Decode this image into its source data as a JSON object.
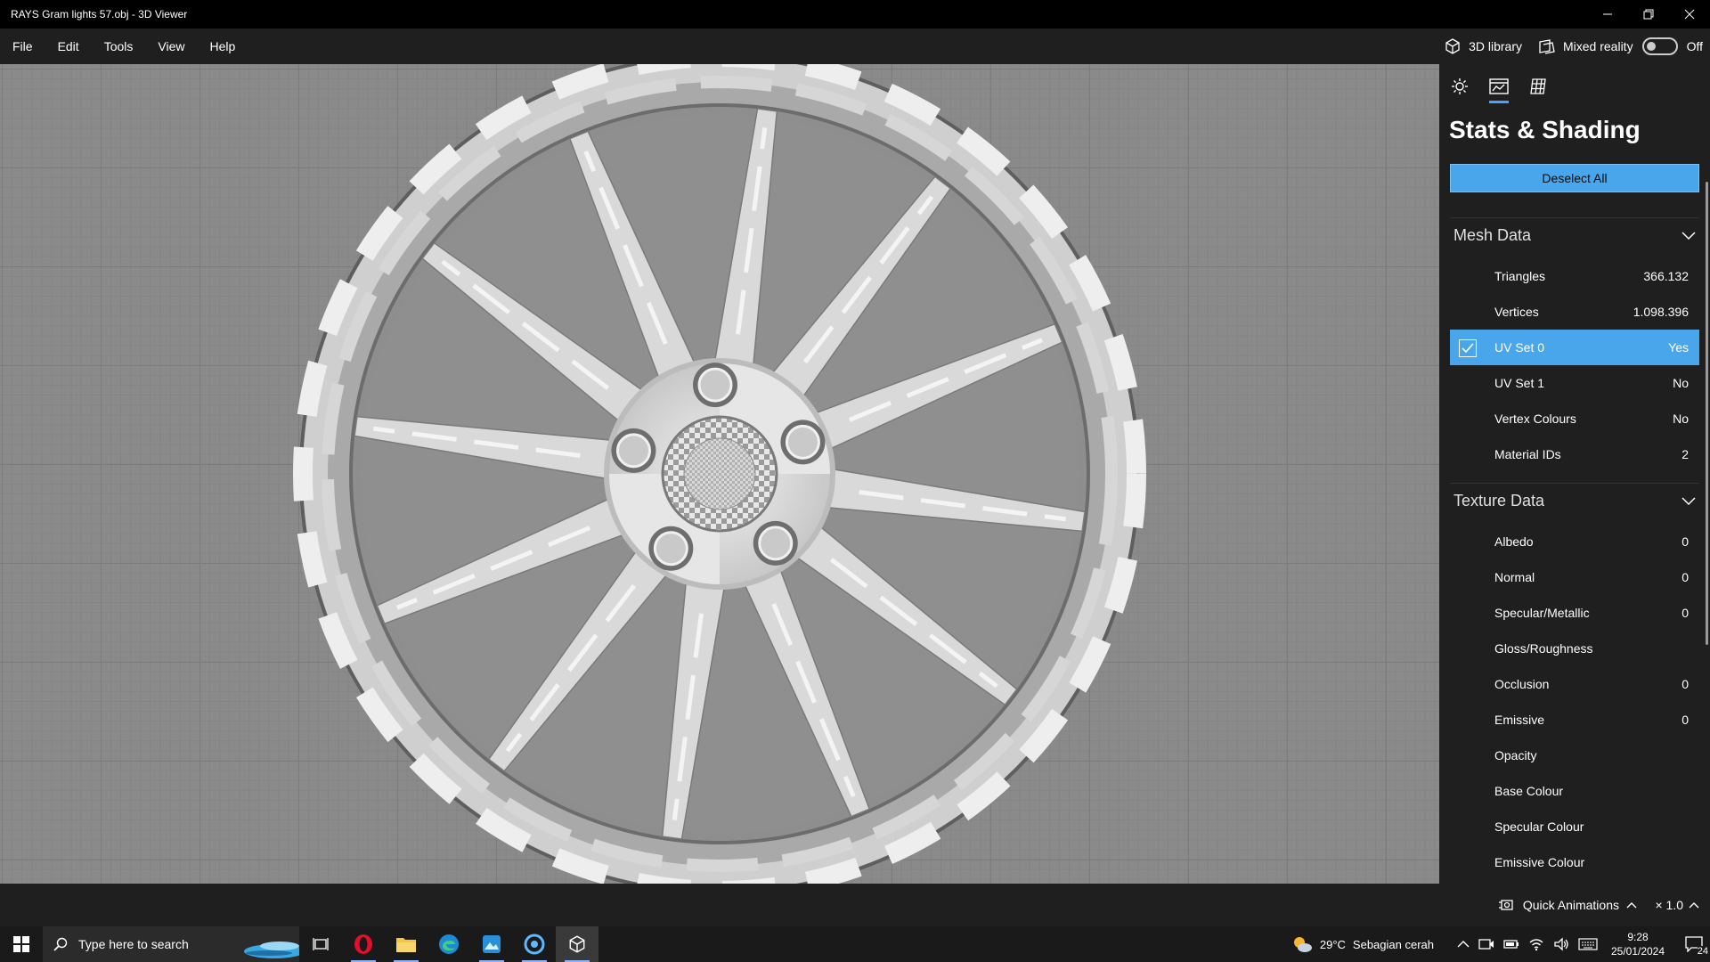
{
  "window": {
    "title": "RAYS Gram lights 57.obj - 3D Viewer"
  },
  "menu": {
    "items": [
      "File",
      "Edit",
      "Tools",
      "View",
      "Help"
    ]
  },
  "header_right": {
    "library_label": "3D library",
    "mixed_reality_label": "Mixed reality",
    "toggle_state": "Off"
  },
  "panel": {
    "title": "Stats & Shading",
    "deselect_label": "Deselect All",
    "mesh_section": "Mesh Data",
    "mesh_rows": [
      {
        "label": "Triangles",
        "value": "366.132"
      },
      {
        "label": "Vertices",
        "value": "1.098.396"
      },
      {
        "label": "UV Set 0",
        "value": "Yes"
      },
      {
        "label": "UV Set 1",
        "value": "No"
      },
      {
        "label": "Vertex Colours",
        "value": "No"
      },
      {
        "label": "Material IDs",
        "value": "2"
      }
    ],
    "texture_section": "Texture Data",
    "texture_rows": [
      {
        "label": "Albedo",
        "value": "0"
      },
      {
        "label": "Normal",
        "value": "0"
      },
      {
        "label": "Specular/Metallic",
        "value": "0"
      },
      {
        "label": "Gloss/Roughness",
        "value": ""
      },
      {
        "label": "Occlusion",
        "value": "0"
      },
      {
        "label": "Emissive",
        "value": "0"
      },
      {
        "label": "Opacity",
        "value": ""
      },
      {
        "label": "Base Colour",
        "value": ""
      },
      {
        "label": "Specular Colour",
        "value": ""
      },
      {
        "label": "Emissive Colour",
        "value": ""
      }
    ]
  },
  "statusbar": {
    "quick_animations": "Quick Animations",
    "speed": "× 1.0"
  },
  "taskbar": {
    "search_placeholder": "Type here to search",
    "weather_temp": "29°C",
    "weather_desc": "Sebagian cerah",
    "time": "9:28",
    "date": "25/01/2024",
    "notification_count": "24"
  },
  "colors": {
    "accent": "#4aa6ea",
    "viewport_bg": "#8a8a8a",
    "panel_bg": "#1f1f1f"
  }
}
